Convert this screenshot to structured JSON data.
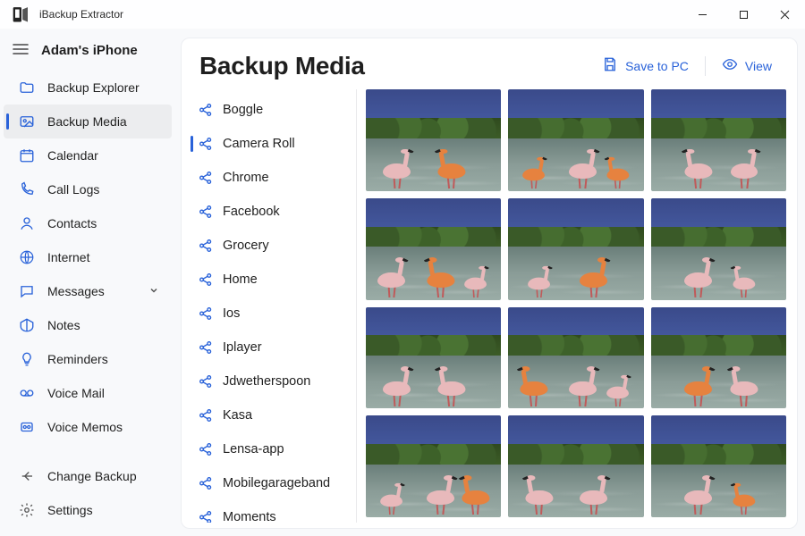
{
  "app": {
    "title": "iBackup Extractor"
  },
  "device": {
    "name": "Adam's iPhone"
  },
  "sidebar": {
    "items": [
      {
        "label": "Backup Explorer",
        "icon": "folder-icon"
      },
      {
        "label": "Backup Media",
        "icon": "photo-icon",
        "selected": true
      },
      {
        "label": "Calendar",
        "icon": "calendar-icon"
      },
      {
        "label": "Call Logs",
        "icon": "phone-icon"
      },
      {
        "label": "Contacts",
        "icon": "person-icon"
      },
      {
        "label": "Internet",
        "icon": "globe-icon"
      },
      {
        "label": "Messages",
        "icon": "chat-icon",
        "expandable": true
      },
      {
        "label": "Notes",
        "icon": "note-icon"
      },
      {
        "label": "Reminders",
        "icon": "bulb-icon"
      },
      {
        "label": "Voice Mail",
        "icon": "voicemail-icon"
      },
      {
        "label": "Voice Memos",
        "icon": "memo-icon"
      }
    ],
    "footer": [
      {
        "label": "Change Backup",
        "icon": "back-arrow-icon"
      },
      {
        "label": "Settings",
        "icon": "gear-icon"
      }
    ]
  },
  "page": {
    "title": "Backup Media",
    "actions": {
      "save": "Save to PC",
      "view": "View"
    }
  },
  "albums": [
    "Boggle",
    "Camera Roll",
    "Chrome",
    "Facebook",
    "Grocery",
    "Home",
    "Ios",
    "Iplayer",
    "Jdwetherspoon",
    "Kasa",
    "Lensa-app",
    "Mobilegarageband",
    "Moments"
  ],
  "albums_selected_index": 1,
  "thumbnails": {
    "count": 12
  }
}
